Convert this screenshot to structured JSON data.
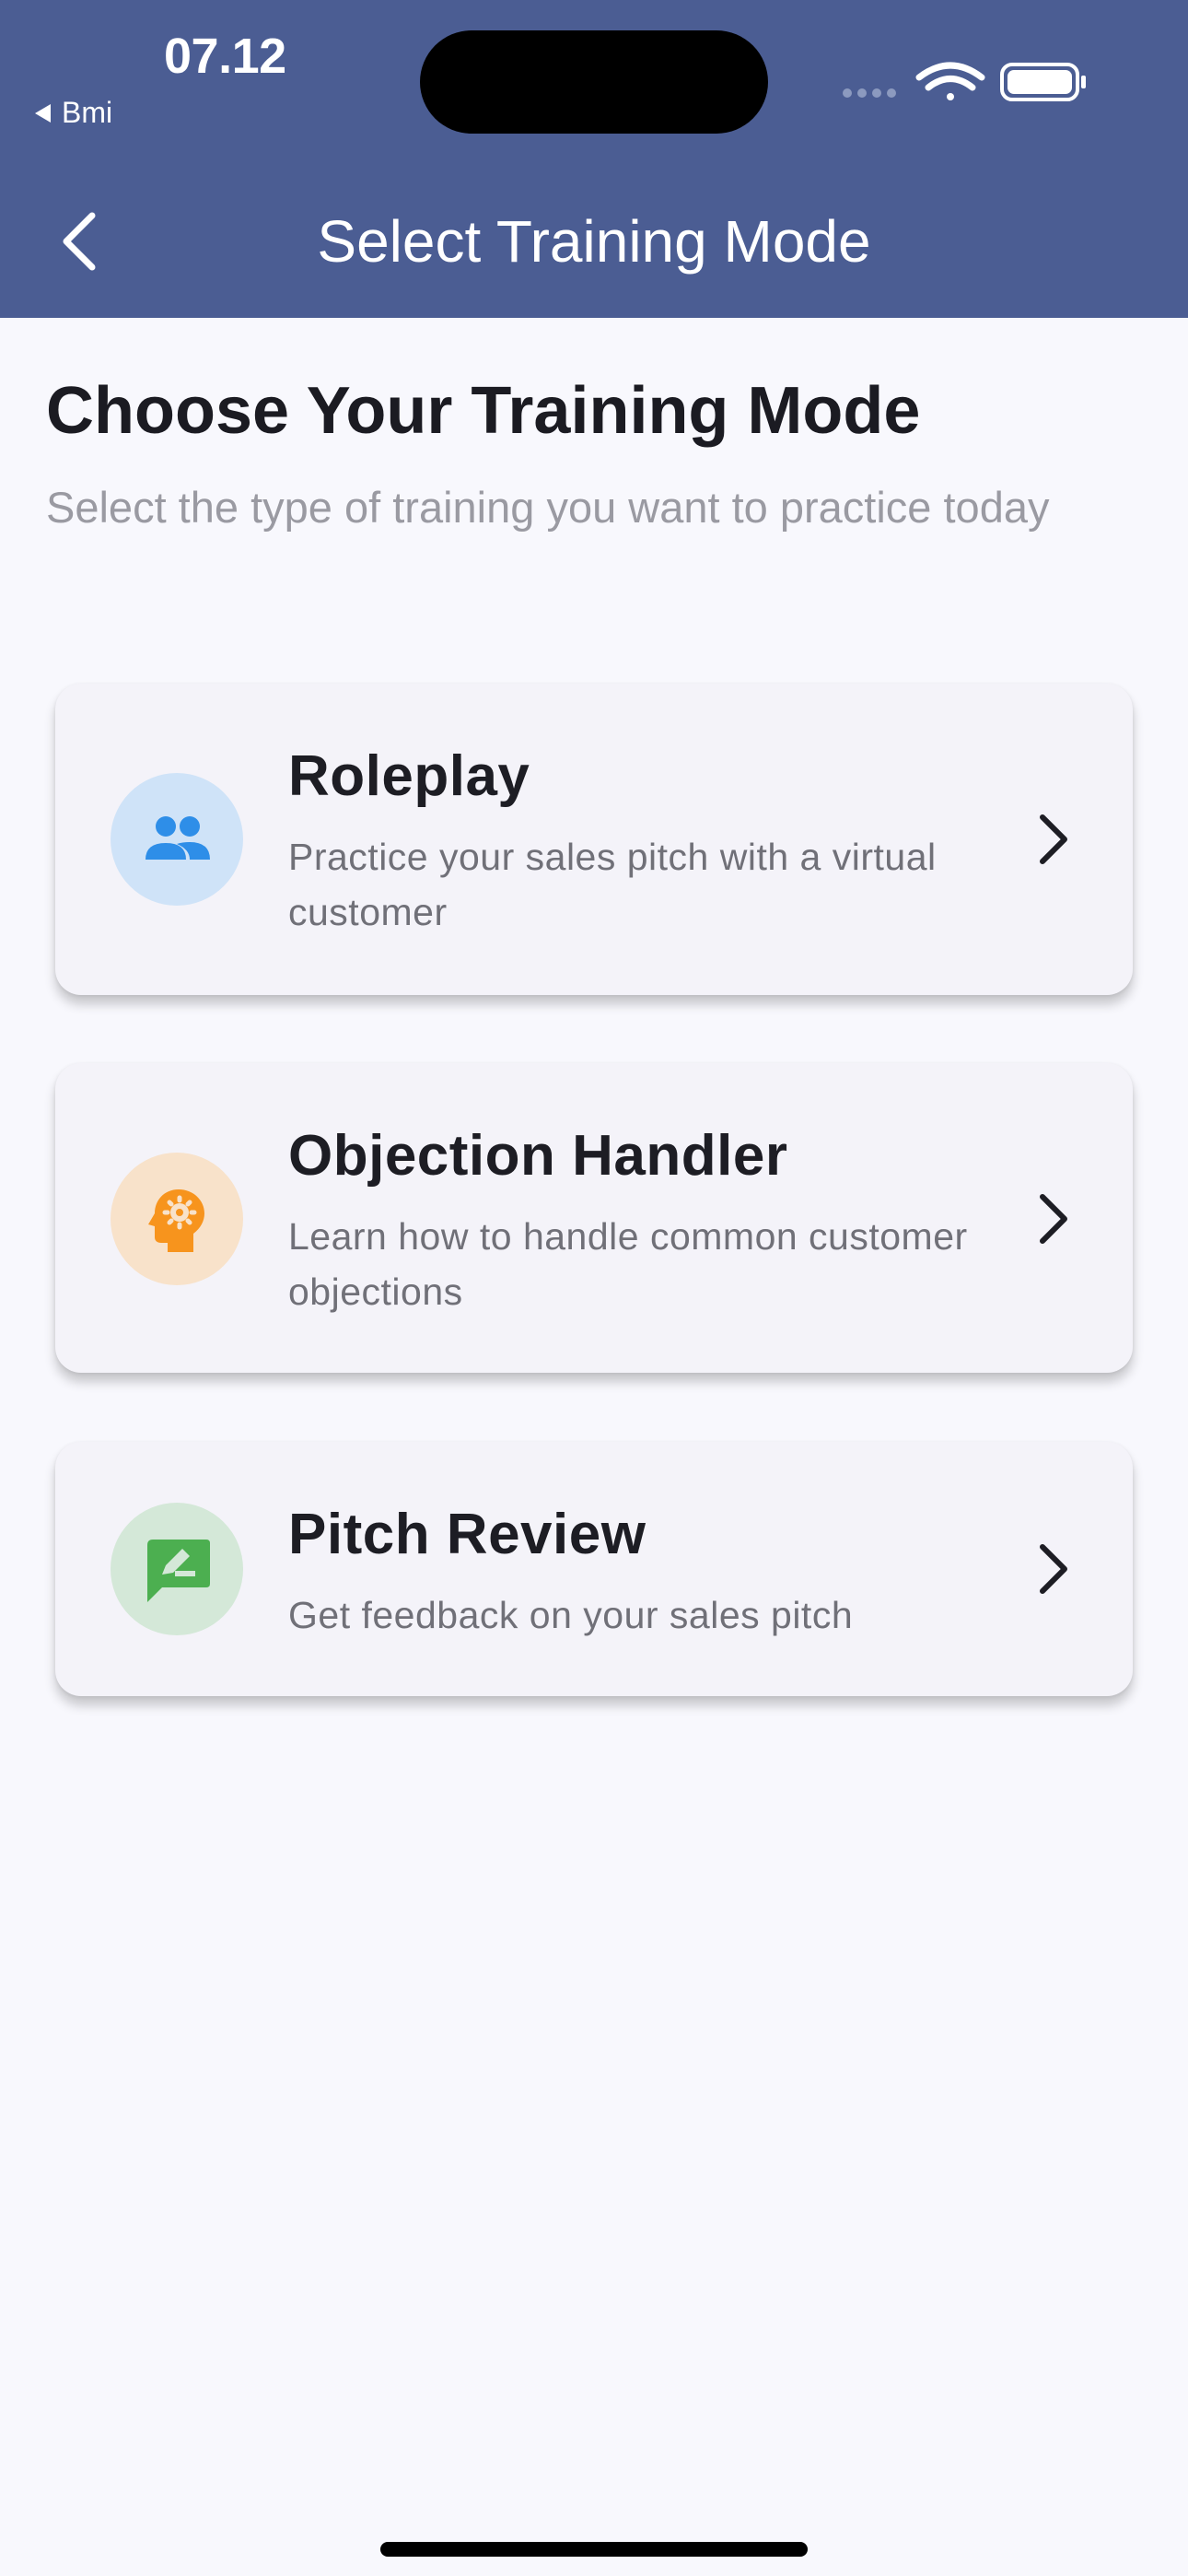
{
  "status_bar": {
    "time": "07.12",
    "back_app": "Bmi",
    "icons": [
      "signal-dots-icon",
      "wifi-icon",
      "battery-icon"
    ]
  },
  "app_bar": {
    "title": "Select Training Mode",
    "background": "#4B5D93",
    "back_icon": "chevron-left-icon"
  },
  "content": {
    "heading": "Choose Your Training Mode",
    "subheading": "Select the type of training you want to practice today"
  },
  "modes": [
    {
      "title": "Roleplay",
      "description": "Practice your sales pitch with a virtual customer",
      "icon": "people-icon",
      "icon_color": "#2E8EE8",
      "icon_bg": "#CFE3F8"
    },
    {
      "title": "Objection Handler",
      "description": "Learn how to handle common customer objections",
      "icon": "head-gear-icon",
      "icon_color": "#F7941D",
      "icon_bg": "#F8E2CA"
    },
    {
      "title": "Pitch Review",
      "description": "Get feedback on your sales pitch",
      "icon": "rate-review-icon",
      "icon_color": "#4CAF50",
      "icon_bg": "#D4E8D8"
    }
  ]
}
